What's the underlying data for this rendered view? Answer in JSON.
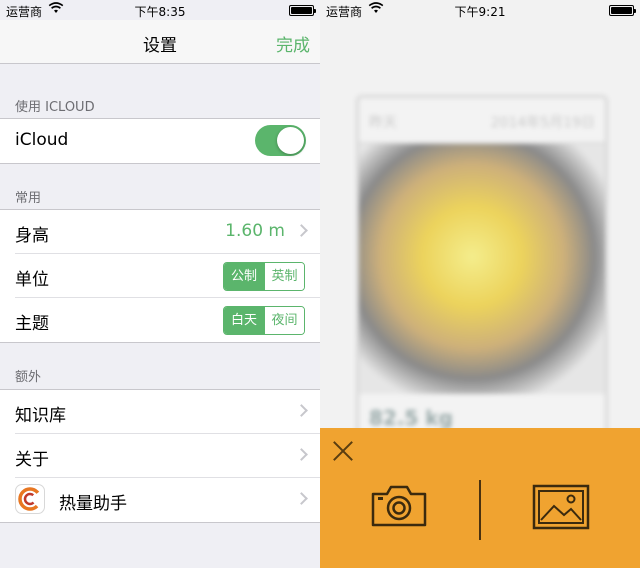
{
  "left": {
    "status": {
      "carrier": "运营商",
      "time": "下午8:35"
    },
    "nav": {
      "title": "设置",
      "done": "完成"
    },
    "sections": {
      "icloud": {
        "header": "使用 ICLOUD",
        "icloud_label": "iCloud",
        "toggle_on": true
      },
      "common": {
        "header": "常用",
        "height_label": "身高",
        "height_value": "1.60 m",
        "unit_label": "单位",
        "unit_options": [
          "公制",
          "英制"
        ],
        "theme_label": "主题",
        "theme_options": [
          "白天",
          "夜间"
        ]
      },
      "extra": {
        "header": "额外",
        "kb_label": "知识库",
        "about_label": "关于",
        "app_label": "热量助手"
      }
    }
  },
  "right": {
    "status": {
      "carrier": "运营商",
      "time": "下午9:21"
    },
    "card": {
      "day": "昨天",
      "date": "2014年5月19日",
      "weight": "82.5 kg"
    }
  },
  "colors": {
    "accent": "#5bb56c",
    "sheet": "#f0a330"
  },
  "icons": [
    "wifi-icon",
    "battery-icon",
    "chevron-right-icon",
    "close-icon",
    "camera-icon",
    "image-icon",
    "app-logo-icon"
  ]
}
